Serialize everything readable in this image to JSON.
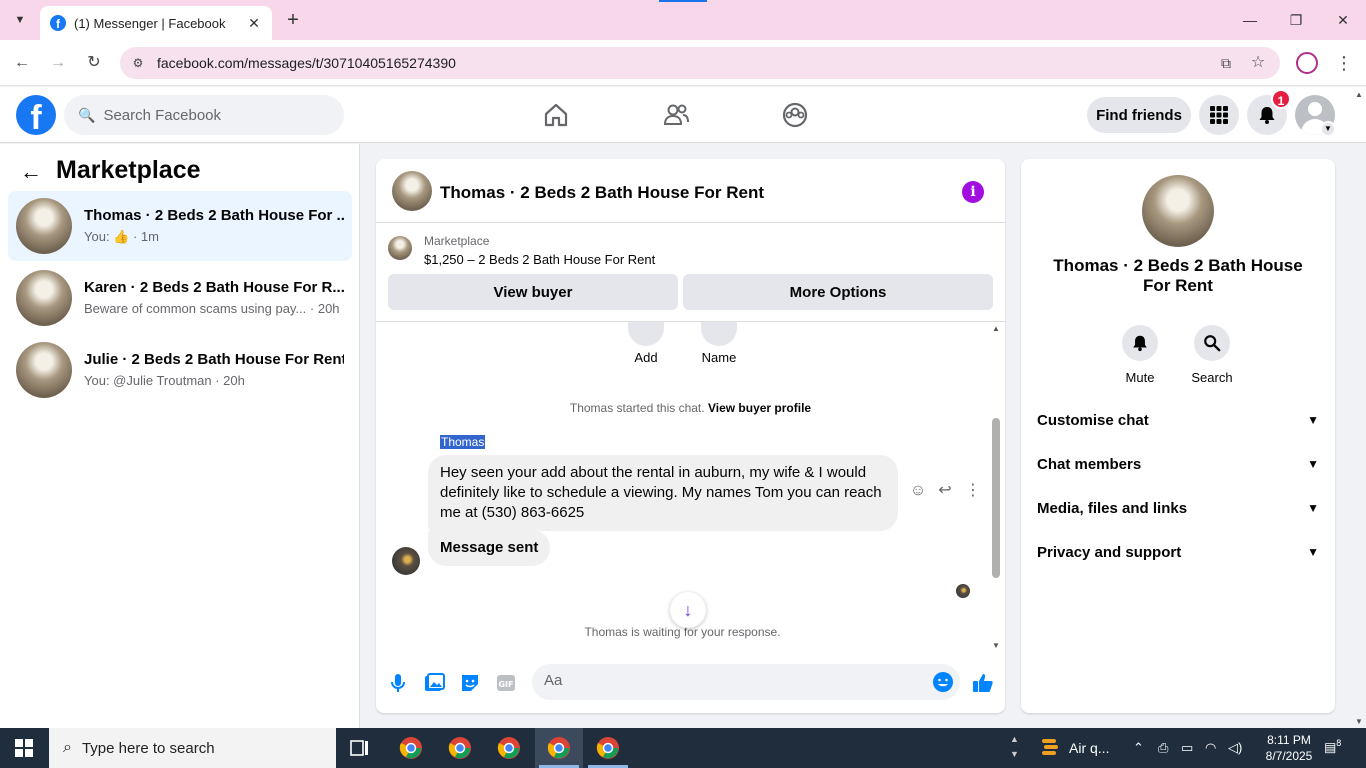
{
  "browser": {
    "tab_title": "(1) Messenger | Facebook",
    "tab_close": "✕",
    "new_tab": "+",
    "url": "facebook.com/messages/t/30710405165274390"
  },
  "fb_header": {
    "search_placeholder": "Search Facebook",
    "find_friends": "Find friends",
    "notification_count": "1"
  },
  "sidebar": {
    "title": "Marketplace",
    "conversations": [
      {
        "name": "Thomas · 2 Beds 2 Bath House For ...",
        "preview": "You: 👍 · 1m",
        "active": true
      },
      {
        "name": "Karen · 2 Beds 2 Bath House For R...",
        "preview": "Beware of common scams using pay... · 20h",
        "active": false
      },
      {
        "name": "Julie · 2 Beds 2 Bath House For Rent",
        "preview": "You: @Julie Troutman · 20h",
        "active": false
      }
    ]
  },
  "chat": {
    "title": "Thomas · 2 Beds 2 Bath House For Rent",
    "marketplace_label": "Marketplace",
    "listing": "$1,250 – 2 Beds 2 Bath House For Rent",
    "view_buyer": "View buyer",
    "more_options": "More Options",
    "quick_add": "Add",
    "quick_name": "Name",
    "started_text": "Thomas started this chat.",
    "view_buyer_profile": "View buyer profile",
    "sender": "Thomas",
    "message_1": "Hey seen your add about the rental in auburn, my wife & I would definitely like to schedule a viewing. My names Tom you can reach me at (530) 863-6625",
    "message_2": "Message sent",
    "waiting": "Thomas is waiting for your response.",
    "composer_placeholder": "Aa"
  },
  "right_panel": {
    "title": "Thomas · 2 Beds 2 Bath House For Rent",
    "mute": "Mute",
    "search": "Search",
    "sections": [
      "Customise chat",
      "Chat members",
      "Media, files and links",
      "Privacy and support"
    ]
  },
  "taskbar": {
    "search_placeholder": "Type here to search",
    "air_quality": "Air q...",
    "time": "8:11 PM",
    "date": "8/7/2025",
    "notification_count": "8"
  },
  "colors": {
    "fb_blue": "#1877f2",
    "messenger_purple": "#a20ee0",
    "active_conv": "#ebf5ff",
    "tab_strip": "#f9d7ea"
  }
}
